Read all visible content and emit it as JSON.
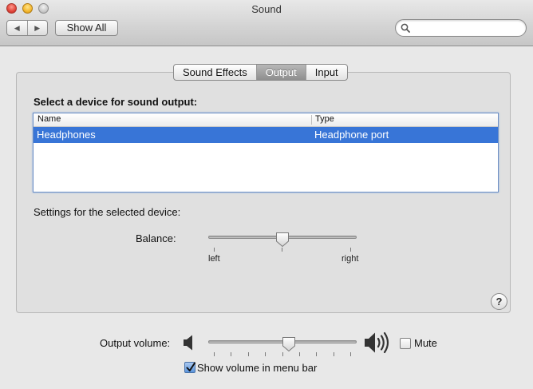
{
  "window": {
    "title": "Sound"
  },
  "toolbar": {
    "back_icon": "chevron-left-icon",
    "forward_icon": "chevron-right-icon",
    "show_all_label": "Show All",
    "search_value": "",
    "search_placeholder": ""
  },
  "tabs": [
    {
      "label": "Sound Effects",
      "selected": false
    },
    {
      "label": "Output",
      "selected": true
    },
    {
      "label": "Input",
      "selected": false
    }
  ],
  "output": {
    "section_title": "Select a device for sound output:",
    "columns": [
      "Name",
      "Type"
    ],
    "devices": [
      {
        "name": "Headphones",
        "type": "Headphone port",
        "selected": true
      }
    ],
    "settings_label": "Settings for the selected device:",
    "balance": {
      "label": "Balance:",
      "left_label": "left",
      "right_label": "right",
      "value": 0.5
    }
  },
  "footer": {
    "volume_label": "Output volume:",
    "volume_value": 0.55,
    "mute_label": "Mute",
    "mute_checked": false,
    "show_volume_label": "Show volume in menu bar",
    "show_volume_checked": true
  },
  "colors": {
    "selection": "#3875d7",
    "accent_focus": "#7ea6e0"
  }
}
